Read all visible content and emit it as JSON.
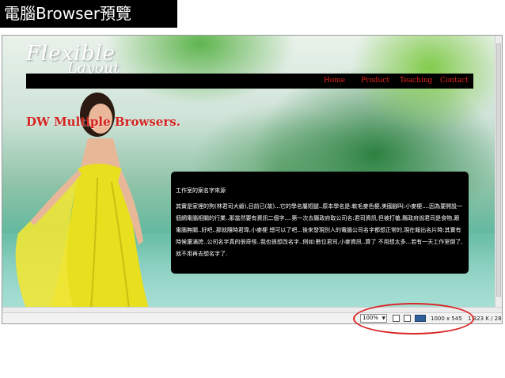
{
  "slide": {
    "title": "電腦Browser預覽"
  },
  "site": {
    "logo_line1": "Flexible",
    "logo_line2": "Layout",
    "nav": [
      {
        "label": "Home"
      },
      {
        "label": "Product"
      },
      {
        "label": "Teaching"
      },
      {
        "label": "Contact"
      }
    ],
    "headline": "DW Multiple Browsers.",
    "content_title": "工作室的案名字來源",
    "content_body": "其實是家裡的狗(林君司大爺),目前已(故)...它的學名屬短腿..原本學名是:軟毛麥色梗,美國腳叫:小麥梗....因為要開設一個網電腦相關的行業..那當然要有資訊二個字....第一次去縣政府取公司名:君司資訊,但被打槍,縣政府說君司是食物,跟電腦無關..好吧..那就隨時君瑋,小麥梗 總可以了吧...後來發現別人的電腦公司名字都想正常的,現在報出名片時:其實有時候還滿誇..公司名字真的很奇怪..我也很想改名字..例如:數位君司,小麥資訊..算了 不用想太多...若有一天工作室倒了,就不用再去想名字了."
  },
  "status": {
    "zoom": "100%",
    "dimensions": "1000 x 545",
    "file_info": "1 323 K / 28 秒"
  },
  "colors": {
    "nav_link": "#e3241b",
    "headline": "#d42420",
    "annotation": "#d92525"
  }
}
